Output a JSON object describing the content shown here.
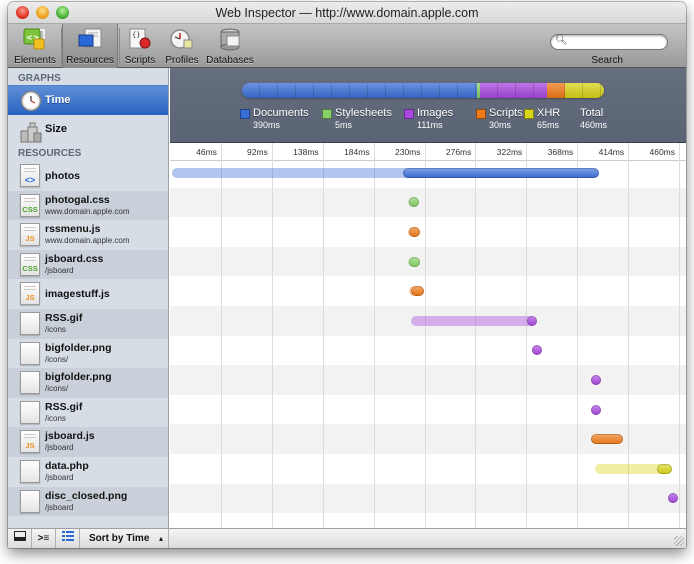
{
  "window": {
    "title": "Web Inspector — http://www.domain.apple.com"
  },
  "toolbar": {
    "buttons": [
      {
        "label": "Elements",
        "icon": "elements-icon"
      },
      {
        "label": "Resources",
        "icon": "resources-icon",
        "selected": true
      },
      {
        "label": "Scripts",
        "icon": "scripts-icon"
      },
      {
        "label": "Profiles",
        "icon": "profiles-icon"
      },
      {
        "label": "Databases",
        "icon": "databases-icon"
      }
    ],
    "search": {
      "placeholder": "",
      "value": "",
      "label": "Search"
    }
  },
  "sidebar": {
    "graphs_header": "GRAPHS",
    "graphs": [
      {
        "label": "Time",
        "icon": "clock-icon",
        "selected": true
      },
      {
        "label": "Size",
        "icon": "weights-icon"
      }
    ],
    "resources_header": "RESOURCES",
    "resources": [
      {
        "name": "photos",
        "sub": "",
        "type": "doc",
        "badge": "<>"
      },
      {
        "name": "photogal.css",
        "sub": "www.domain.apple.com",
        "type": "css",
        "badge": "CSS"
      },
      {
        "name": "rssmenu.js",
        "sub": "www.domain.apple.com",
        "type": "js",
        "badge": "JS"
      },
      {
        "name": "jsboard.css",
        "sub": "/jsboard",
        "type": "css",
        "badge": "CSS"
      },
      {
        "name": "imagestuff.js",
        "sub": "",
        "type": "js",
        "badge": "JS"
      },
      {
        "name": "RSS.gif",
        "sub": "/icons",
        "type": "img",
        "badge": ""
      },
      {
        "name": "bigfolder.png",
        "sub": "/icons/",
        "type": "img",
        "badge": ""
      },
      {
        "name": "bigfolder.png",
        "sub": "/icons/",
        "type": "img",
        "badge": ""
      },
      {
        "name": "RSS.gif",
        "sub": "/icons",
        "type": "img",
        "badge": ""
      },
      {
        "name": "jsboard.js",
        "sub": "/jsboard",
        "type": "js",
        "badge": "JS"
      },
      {
        "name": "data.php",
        "sub": "/jsboard",
        "type": "xhr",
        "badge": ""
      },
      {
        "name": "disc_closed.png",
        "sub": "/jsboard",
        "type": "img",
        "badge": ""
      }
    ]
  },
  "statusbar": {
    "buttons": [
      {
        "icon": "dock-icon"
      },
      {
        "icon": "console-icon"
      },
      {
        "icon": "large-rows-icon"
      }
    ],
    "sort_label": "Sort by Time"
  },
  "summary": {
    "colors": {
      "Documents": "#3b6fd8",
      "Stylesheets": "#86d066",
      "Images": "#a848e0",
      "Scripts": "#f07a18",
      "XHR": "#d8d418"
    },
    "categories": [
      {
        "name": "Documents",
        "value": "390ms",
        "ms": 390
      },
      {
        "name": "Stylesheets",
        "value": "5ms",
        "ms": 5
      },
      {
        "name": "Images",
        "value": "111ms",
        "ms": 111
      },
      {
        "name": "Scripts",
        "value": "30ms",
        "ms": 30
      },
      {
        "name": "XHR",
        "value": "65ms",
        "ms": 65
      }
    ],
    "total_label": "Total",
    "total_value": "460ms"
  },
  "timeline": {
    "ticks": [
      "46ms",
      "92ms",
      "138ms",
      "184ms",
      "230ms",
      "276ms",
      "322ms",
      "368ms",
      "414ms",
      "460ms"
    ],
    "max_ms": 460,
    "rows": [
      {
        "category": "Documents",
        "start": 0,
        "response": 211,
        "end": 388
      },
      {
        "category": "Stylesheets",
        "start": 213,
        "response": 216,
        "end": 225
      },
      {
        "category": "Scripts",
        "start": 213,
        "response": 216,
        "end": 226
      },
      {
        "category": "Stylesheets",
        "start": 213,
        "response": 216,
        "end": 226
      },
      {
        "category": "Scripts",
        "start": 214,
        "response": 218,
        "end": 230
      },
      {
        "category": "Images",
        "start": 216,
        "response": 323,
        "end": 331
      },
      {
        "category": "Images",
        "start": 325,
        "response": 325,
        "end": 333
      },
      {
        "category": "Images",
        "start": 379,
        "response": 379,
        "end": 387
      },
      {
        "category": "Images",
        "start": 379,
        "response": 379,
        "end": 387
      },
      {
        "category": "Scripts",
        "start": 379,
        "response": 379,
        "end": 409
      },
      {
        "category": "Images_XHR",
        "start": 382,
        "response": 440,
        "end": 454
      },
      {
        "category": "Images",
        "start": 448,
        "response": 448,
        "end": 456
      }
    ]
  }
}
